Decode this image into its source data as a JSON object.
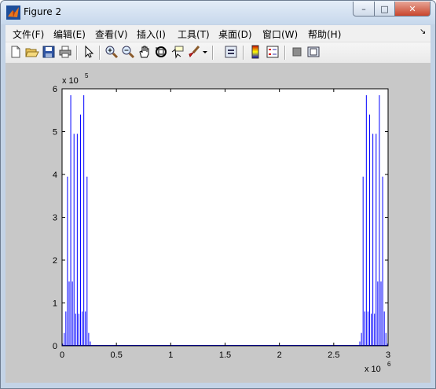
{
  "window": {
    "title": "Figure 2",
    "minimize_glyph": "–",
    "maximize_glyph": "□",
    "close_glyph": "✕"
  },
  "menu": {
    "items": [
      "文件(F)",
      "编辑(E)",
      "查看(V)",
      "插入(I)",
      "工具(T)",
      "桌面(D)",
      "窗口(W)",
      "帮助(H)"
    ],
    "dock_glyph": "↘"
  },
  "toolbar": {
    "icons": [
      "new-figure-icon",
      "open-file-icon",
      "save-icon",
      "print-icon",
      "edit-pointer-icon",
      "zoom-in-icon",
      "zoom-out-icon",
      "pan-icon",
      "rotate-3d-icon",
      "data-cursor-icon",
      "brush-icon",
      "brush-dropdown-icon",
      "link-plot-icon",
      "insert-colorbar-icon",
      "insert-legend-icon",
      "hide-plot-tools-icon",
      "show-plot-tools-icon"
    ]
  },
  "chart_data": {
    "type": "bar",
    "y_exponent_label": "x 10",
    "y_exponent": "5",
    "x_exponent_label": "x 10",
    "x_exponent": "6",
    "xlim": [
      0,
      3
    ],
    "ylim": [
      0,
      6
    ],
    "x_ticks": [
      "0",
      "0.5",
      "1",
      "1.5",
      "2",
      "2.5",
      "3"
    ],
    "y_ticks": [
      "0",
      "1",
      "2",
      "3",
      "4",
      "5",
      "6"
    ],
    "series_color": "#0000ff",
    "x": [
      0.005,
      0.02,
      0.035,
      0.05,
      0.065,
      0.08,
      0.095,
      0.11,
      0.125,
      0.14,
      0.155,
      0.17,
      0.185,
      0.2,
      0.215,
      0.23,
      0.245,
      0.26,
      0.275,
      2.725,
      2.74,
      2.755,
      2.77,
      2.785,
      2.8,
      2.815,
      2.83,
      2.845,
      2.86,
      2.875,
      2.89,
      2.905,
      2.92,
      2.935,
      2.95,
      2.965,
      2.98,
      2.995
    ],
    "values": [
      0.05,
      0.3,
      0.8,
      3.95,
      1.5,
      5.85,
      1.5,
      4.95,
      0.75,
      4.95,
      0.75,
      5.4,
      0.8,
      5.85,
      0.8,
      3.95,
      0.3,
      0.1,
      0.02,
      0.02,
      0.1,
      0.3,
      3.95,
      0.8,
      5.85,
      0.8,
      5.4,
      0.75,
      4.95,
      0.75,
      4.95,
      1.5,
      5.85,
      1.5,
      3.95,
      0.8,
      0.3,
      0.05
    ]
  }
}
